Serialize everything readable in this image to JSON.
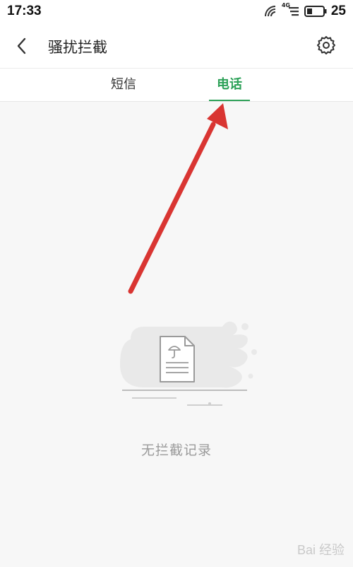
{
  "status_bar": {
    "time": "17:33",
    "network_label": "4G",
    "battery_level": "25"
  },
  "header": {
    "title": "骚扰拦截",
    "back_icon": "chevron-left-icon",
    "settings_icon": "gear-icon"
  },
  "tabs": [
    {
      "label": "短信",
      "selected": false
    },
    {
      "label": "电话",
      "selected": true
    }
  ],
  "empty_state": {
    "message": "无拦截记录",
    "icon": "document-umbrella-icon"
  },
  "watermark": {
    "text": "Bai 经验"
  },
  "colors": {
    "accent": "#2da158",
    "annotation_arrow": "#d93532",
    "background": "#f7f7f7"
  }
}
